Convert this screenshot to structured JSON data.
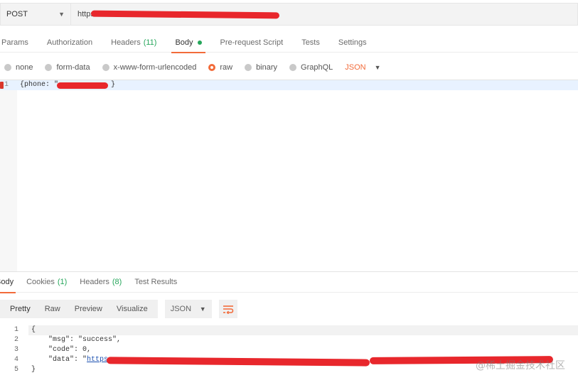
{
  "request": {
    "method": "POST",
    "url": "https"
  },
  "request_tabs": {
    "params": "Params",
    "authorization": "Authorization",
    "headers": "Headers",
    "headers_count": "(11)",
    "body": "Body",
    "prerequest": "Pre-request Script",
    "tests": "Tests",
    "settings": "Settings"
  },
  "body_types": {
    "none": "none",
    "form_data": "form-data",
    "urlencoded": "x-www-form-urlencoded",
    "raw": "raw",
    "binary": "binary",
    "graphql": "GraphQL",
    "format": "JSON"
  },
  "editor": {
    "line_number": "1",
    "line1_start": "{phone: \"",
    "line1_end": "}"
  },
  "response_tabs": {
    "body": "Body",
    "cookies": "Cookies",
    "cookies_count": "(1)",
    "headers": "Headers",
    "headers_count": "(8)",
    "test_results": "Test Results"
  },
  "view": {
    "pretty": "Pretty",
    "raw": "Raw",
    "preview": "Preview",
    "visualize": "Visualize",
    "format": "JSON"
  },
  "response": {
    "ln1": "1",
    "ln2": "2",
    "ln3": "3",
    "ln4": "4",
    "ln5": "5",
    "line1": "{",
    "line2": "    \"msg\": \"success\",",
    "line3": "    \"code\": 0,",
    "line4_key": "    \"data\": ",
    "line4_q": "\"",
    "line4_link": "https",
    "line5": "}"
  },
  "watermark": "@稀土掘金技术社区",
  "colors": {
    "accent": "#f26b3a",
    "count_green": "#26a65b",
    "redaction": "#e8272c"
  }
}
